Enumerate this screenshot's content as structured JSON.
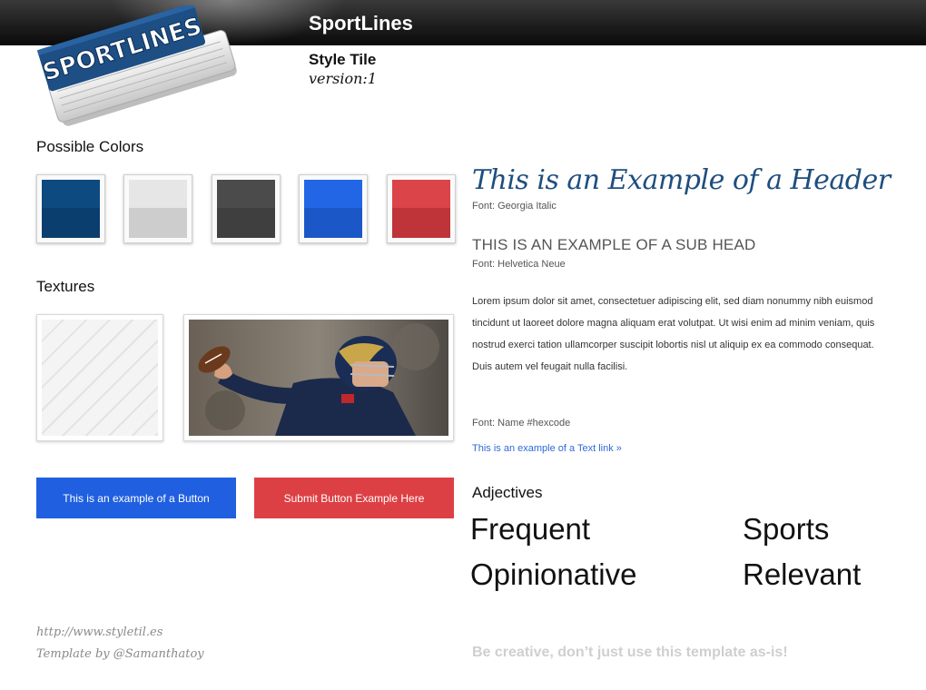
{
  "header": {
    "brand_title": "SportLines",
    "tile_label": "Style Tile",
    "version": "version:1",
    "logo_text": "SPORTLINES"
  },
  "colors": {
    "label": "Possible Colors",
    "swatches": [
      {
        "name": "navy",
        "top": "#0c4a80",
        "bottom": "#0a3e6e"
      },
      {
        "name": "light-gray",
        "top": "#e6e6e6",
        "bottom": "#cdcdcd"
      },
      {
        "name": "dark-gray",
        "top": "#4b4b4b",
        "bottom": "#3f3f3f"
      },
      {
        "name": "blue",
        "top": "#2266e6",
        "bottom": "#1c57c8"
      },
      {
        "name": "red",
        "top": "#db4448",
        "bottom": "#bf3438"
      }
    ]
  },
  "textures": {
    "label": "Textures"
  },
  "buttons": {
    "primary_label": "This is an example of a Button",
    "submit_label": "Submit Button Example Here",
    "primary_color": "#2060e0",
    "submit_color": "#dd4044"
  },
  "typography": {
    "header_example": "This is an Example of a Header",
    "header_font": "Font:  Georgia Italic",
    "subhead_example": "THIS IS AN EXAMPLE OF A SUB HEAD",
    "subhead_font": "Font: Helvetica Neue",
    "body_text": "Lorem ipsum dolor sit amet, consectetuer adipiscing elit, sed diam nonummy nibh euismod tincidunt ut laoreet dolore magna aliquam erat volutpat. Ut wisi enim ad minim veniam, quis nostrud exerci tation ullamcorper suscipit lobortis nisl ut aliquip ex ea commodo consequat. Duis autem vel feugait nulla facilisi.",
    "body_font": "Font: Name #hexcode",
    "text_link": "This is an example of a Text link »",
    "header_color": "#1e4e7e",
    "link_color": "#2f6ad8"
  },
  "adjectives": {
    "label": "Adjectives",
    "words": [
      "Frequent",
      "Sports",
      "Opinionative",
      "Relevant"
    ]
  },
  "footer": {
    "url": "http://www.styletil.es",
    "credit": "Template by @Samanthatoy",
    "tagline": "Be creative, don’t just use this template as-is!"
  }
}
